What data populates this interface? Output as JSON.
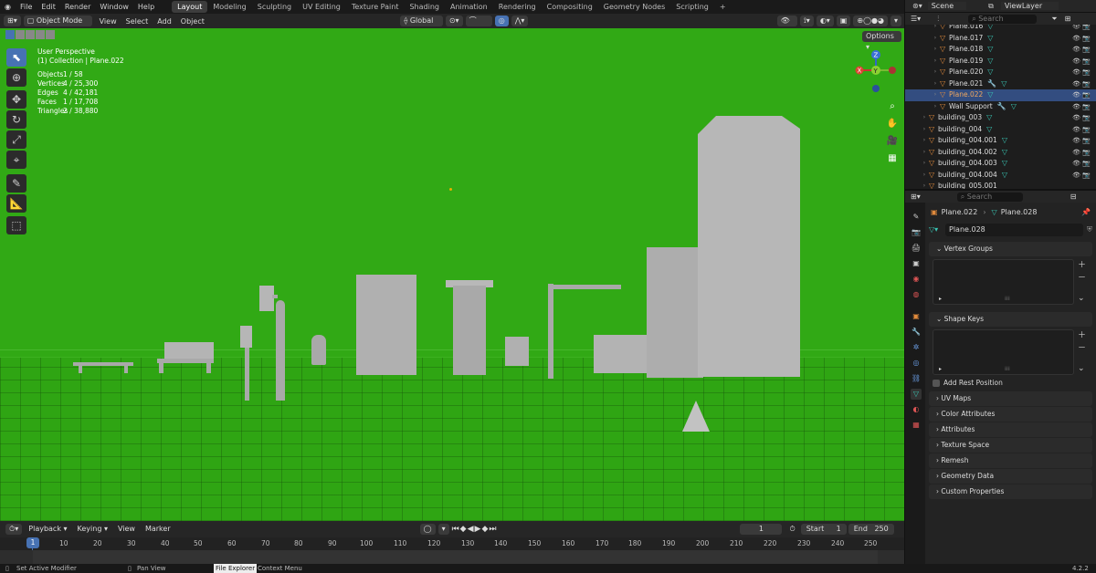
{
  "menu": [
    "File",
    "Edit",
    "Render",
    "Window",
    "Help"
  ],
  "workspaces": [
    "Layout",
    "Modeling",
    "Sculpting",
    "UV Editing",
    "Texture Paint",
    "Shading",
    "Animation",
    "Rendering",
    "Compositing",
    "Geometry Nodes",
    "Scripting",
    "+"
  ],
  "viewport_header": {
    "mode": "Object Mode",
    "view": "View",
    "select": "Select",
    "add": "Add",
    "object": "Object",
    "orientation": "Global",
    "options": "Options"
  },
  "overlay": {
    "perspective": "User Perspective",
    "collection": "(1) Collection | Plane.022",
    "stats": [
      {
        "k": "Objects",
        "v": "1 / 58"
      },
      {
        "k": "Vertices",
        "v": "4 / 25,300"
      },
      {
        "k": "Edges",
        "v": "4 / 42,181"
      },
      {
        "k": "Faces",
        "v": "1 / 17,708"
      },
      {
        "k": "Triangles",
        "v": "2 / 38,880"
      }
    ]
  },
  "scene": "Scene",
  "viewlayer": "ViewLayer",
  "search": "Search",
  "outliner": [
    "Plane.016",
    "Plane.017",
    "Plane.018",
    "Plane.019",
    "Plane.020",
    "Plane.021",
    "Plane.022",
    "Wall Support",
    "building_003",
    "building_004",
    "building_004.001",
    "building_004.002",
    "building_004.003",
    "building_004.004",
    "building_005.001"
  ],
  "props": {
    "breadcrumb_obj": "Plane.022",
    "breadcrumb_mesh": "Plane.028",
    "mesh_name": "Plane.028",
    "vertex_groups": "Vertex Groups",
    "shape_keys": "Shape Keys",
    "add_rest": "Add Rest Position",
    "panels": [
      "UV Maps",
      "Color Attributes",
      "Attributes",
      "Texture Space",
      "Remesh",
      "Geometry Data",
      "Custom Properties"
    ]
  },
  "timeline": {
    "playback": "Playback",
    "keying": "Keying",
    "view": "View",
    "marker": "Marker",
    "current": "1",
    "start_label": "Start",
    "start": "1",
    "end_label": "End",
    "end": "250",
    "ticks": [
      "1",
      "10",
      "20",
      "30",
      "40",
      "50",
      "60",
      "70",
      "80",
      "90",
      "100",
      "110",
      "120",
      "130",
      "140",
      "150",
      "160",
      "170",
      "180",
      "190",
      "200",
      "210",
      "220",
      "230",
      "240",
      "250"
    ]
  },
  "status": {
    "left": "Set Active Modifier",
    "mid": "Pan View",
    "file_explorer": "File Explorer",
    "context": "Context Menu",
    "version": "4.2.2"
  },
  "colors": {
    "viewport_bg": "#31a915",
    "selection": "#334d80",
    "accent": "#4772b3"
  }
}
